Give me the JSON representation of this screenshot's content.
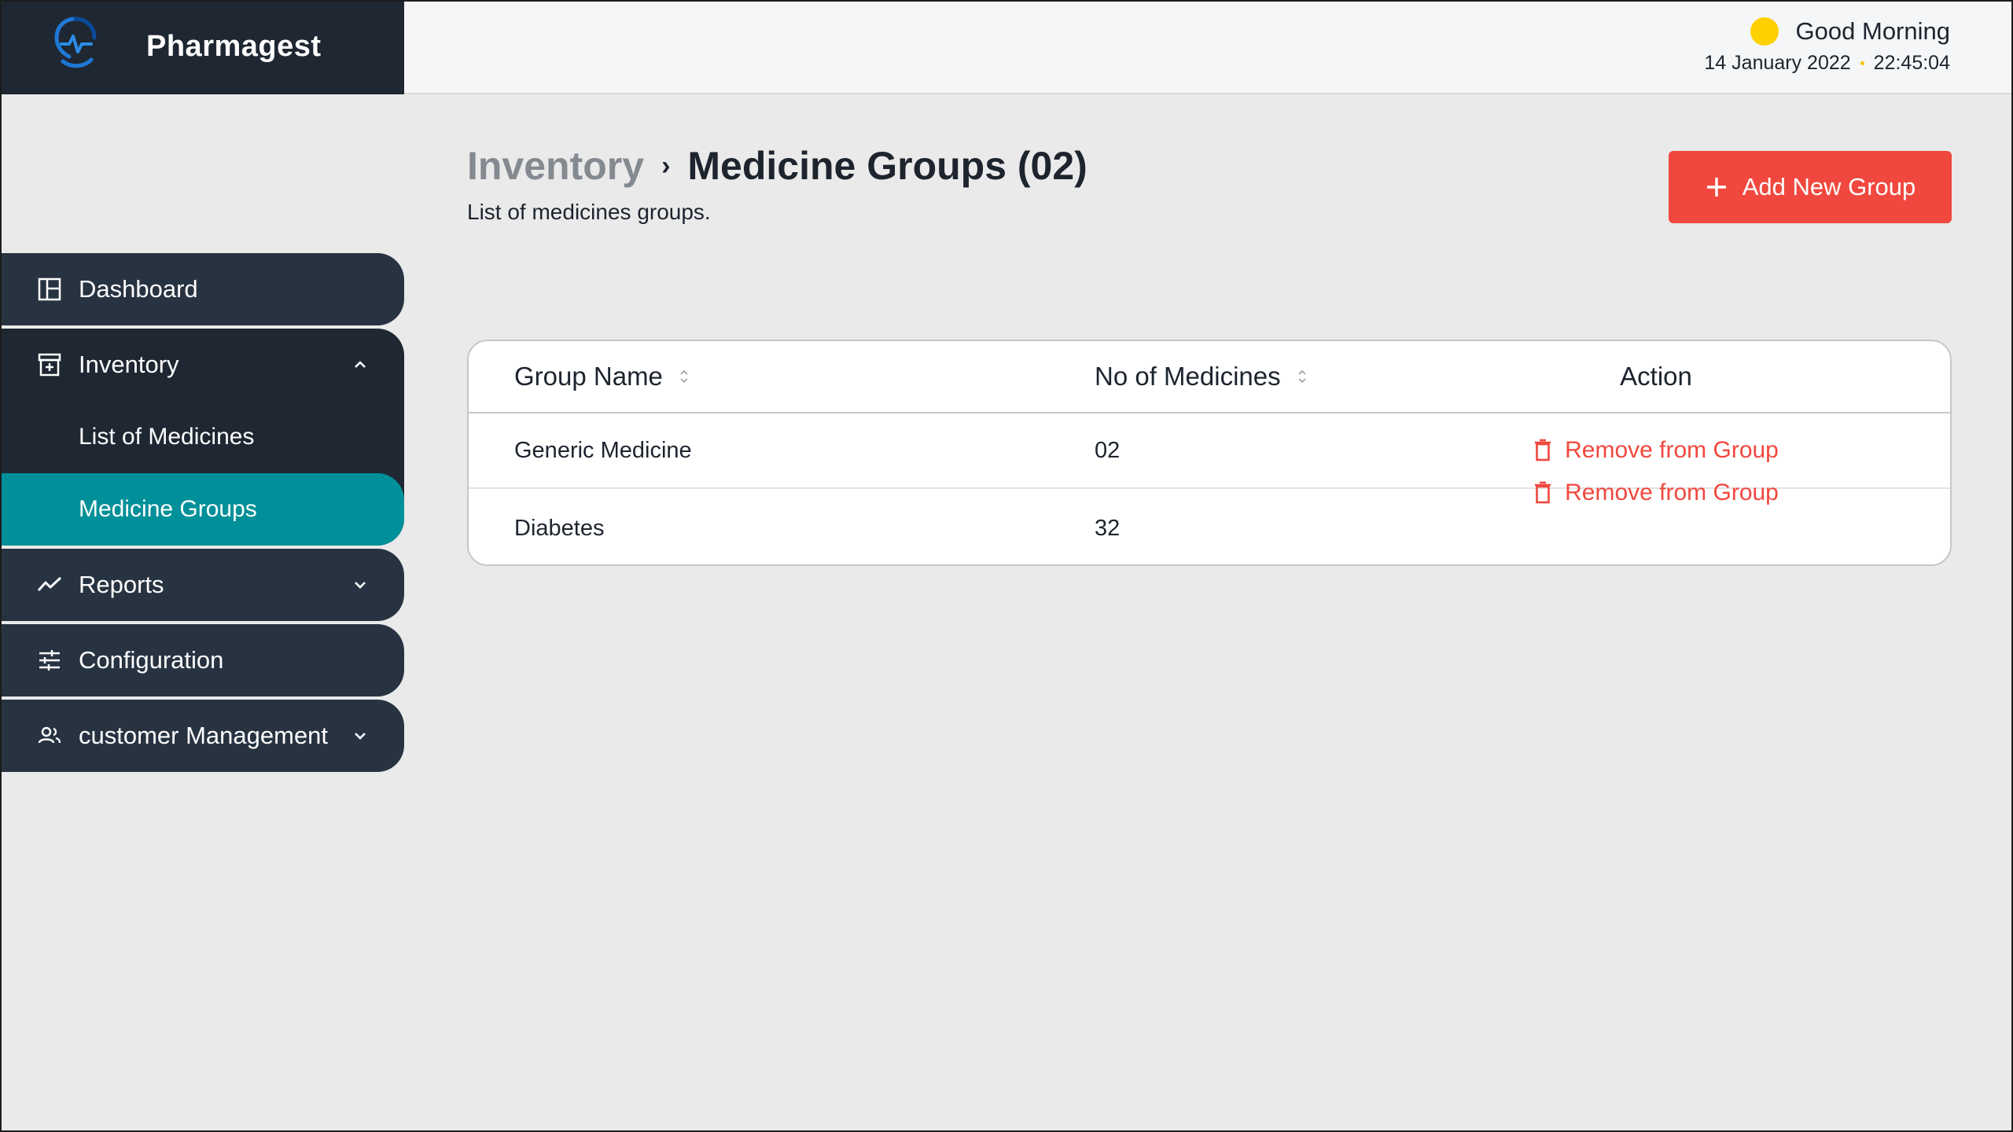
{
  "app": {
    "name": "Pharmagest"
  },
  "header": {
    "greeting": "Good Morning",
    "date": "14 January 2022",
    "time": "22:45:04",
    "sun_color": "#FFD000"
  },
  "sidebar": {
    "items": [
      {
        "label": "Dashboard",
        "icon": "dashboard-icon"
      },
      {
        "label": "Inventory",
        "icon": "inventory-icon",
        "expanded": true,
        "children": [
          {
            "label": "List of Medicines",
            "active": false
          },
          {
            "label": "Medicine Groups",
            "active": true
          }
        ]
      },
      {
        "label": "Reports",
        "icon": "reports-icon",
        "expanded": false
      },
      {
        "label": "Configuration",
        "icon": "configuration-icon"
      },
      {
        "label": "customer Management",
        "icon": "customers-icon",
        "expanded": false
      }
    ]
  },
  "page": {
    "breadcrumb_parent": "Inventory",
    "breadcrumb_separator": "›",
    "title": "Medicine Groups (02)",
    "subtitle": "List of medicines groups.",
    "add_button_label": "Add New Group"
  },
  "table": {
    "columns": [
      "Group Name",
      "No of Medicines",
      "Action"
    ],
    "rows": [
      {
        "group_name": "Generic Medicine",
        "count": "02",
        "action": "Remove from Group"
      },
      {
        "group_name": "Diabetes",
        "count": "32",
        "action": "Remove from Group"
      }
    ]
  },
  "colors": {
    "sidebar_dark": "#1E2732",
    "sidebar_item": "#283342",
    "active_teal": "#009099",
    "accent_red": "#F0483E"
  }
}
